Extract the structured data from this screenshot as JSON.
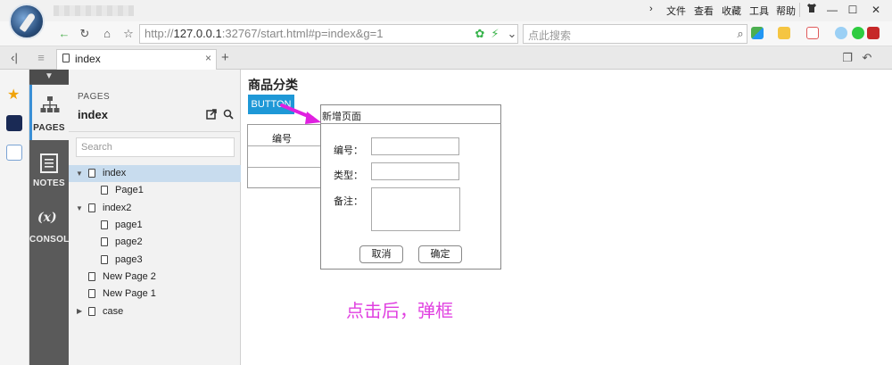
{
  "browser": {
    "menu": [
      "文件",
      "查看",
      "收藏",
      "工具",
      "帮助"
    ],
    "address": {
      "prefix": "http://",
      "host": "127.0.0.1",
      "path": ":32767/start.html#p=index&g=1"
    },
    "search_placeholder": "点此搜索",
    "tab_label": "index",
    "tab_close": "×",
    "new_tab": "+"
  },
  "sidebar_nav": {
    "pages_label": "PAGES",
    "notes_label": "NOTES",
    "console_label": "CONSOL",
    "variables_glyph": "(x)"
  },
  "pages_panel": {
    "caption": "PAGES",
    "title": "index",
    "search_placeholder": "Search",
    "tree": [
      {
        "label": "index",
        "level": 0,
        "expanded": true,
        "selected": true
      },
      {
        "label": "Page1",
        "level": 1
      },
      {
        "label": "index2",
        "level": 0,
        "expanded": true
      },
      {
        "label": "page1",
        "level": 1
      },
      {
        "label": "page2",
        "level": 1
      },
      {
        "label": "page3",
        "level": 1
      },
      {
        "label": "New Page 2",
        "level": 0
      },
      {
        "label": "New Page 1",
        "level": 0
      },
      {
        "label": "case",
        "level": 0,
        "collapsed": true
      }
    ]
  },
  "canvas": {
    "heading": "商品分类",
    "button_label": "BUTTON",
    "table_header": "编号",
    "dialog": {
      "title": "新增页面",
      "field_number": "编号：",
      "field_type": "类型：",
      "field_note": "备注：",
      "cancel": "取消",
      "confirm": "确定"
    },
    "annotation": "点击后，弹框"
  },
  "colors": {
    "accent_blue": "#1e98d7",
    "selection": "#c8dcee",
    "annotation": "#e040e0"
  }
}
